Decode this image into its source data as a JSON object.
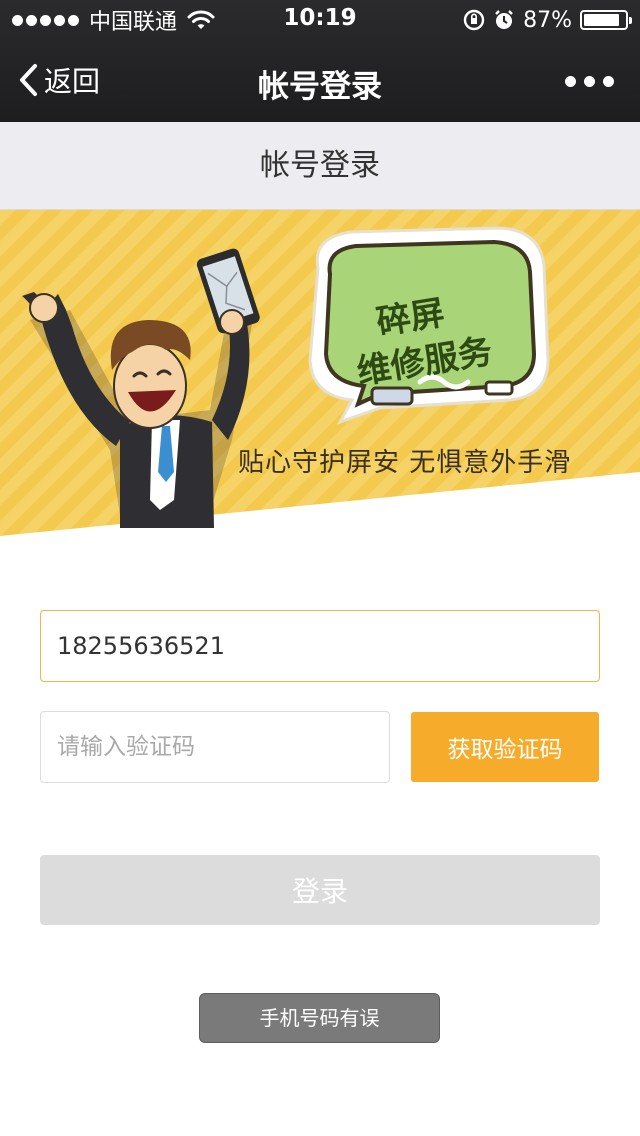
{
  "status_bar": {
    "carrier": "中国联通",
    "time": "10:19",
    "battery_percent": "87%",
    "battery_level": 0.87
  },
  "nav": {
    "back_label": "返回",
    "title": "帐号登录"
  },
  "page_header": {
    "title": "帐号登录"
  },
  "banner": {
    "bubble_line1": "碎屏",
    "bubble_line2": "维修服务",
    "slogan": "贴心守护屏安  无惧意外手滑",
    "colors": {
      "background": "#f3c94e",
      "bubble": "#a9d477"
    }
  },
  "form": {
    "phone_value": "18255636521",
    "code_placeholder": "请输入验证码",
    "get_code_label": "获取验证码",
    "login_label": "登录"
  },
  "toast": {
    "message": "手机号码有误"
  },
  "colors": {
    "accent": "#f6ac2a",
    "disabled_button": "#dcdcdc",
    "nav_background": "#242426"
  }
}
